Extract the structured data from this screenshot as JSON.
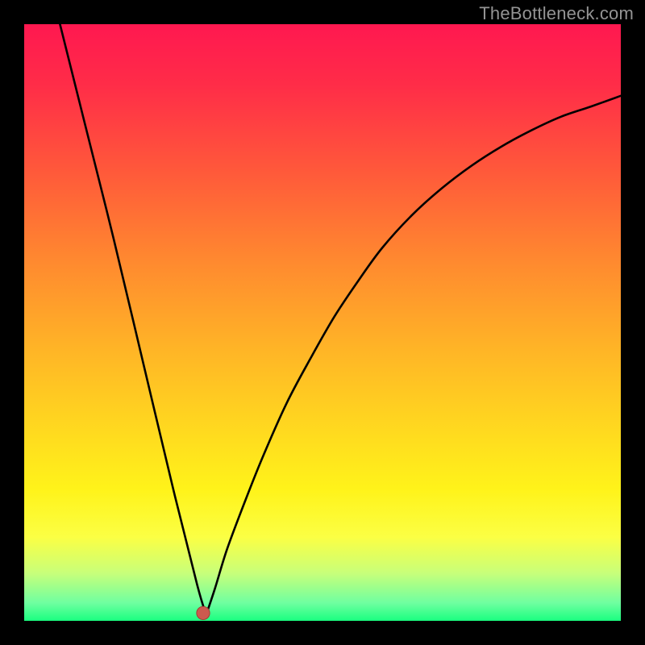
{
  "watermark": "TheBottleneck.com",
  "colors": {
    "frame": "#000000",
    "gradient_stops": [
      {
        "offset": 0.0,
        "color": "#ff1850"
      },
      {
        "offset": 0.1,
        "color": "#ff2c48"
      },
      {
        "offset": 0.25,
        "color": "#ff5a3a"
      },
      {
        "offset": 0.4,
        "color": "#ff8a2f"
      },
      {
        "offset": 0.55,
        "color": "#ffb626"
      },
      {
        "offset": 0.68,
        "color": "#ffd91f"
      },
      {
        "offset": 0.78,
        "color": "#fff31a"
      },
      {
        "offset": 0.86,
        "color": "#fbff44"
      },
      {
        "offset": 0.92,
        "color": "#c8ff7a"
      },
      {
        "offset": 0.97,
        "color": "#6fffa0"
      },
      {
        "offset": 1.0,
        "color": "#1aff80"
      }
    ]
  },
  "chart_data": {
    "type": "line",
    "title": "",
    "xlabel": "",
    "ylabel": "",
    "xlim": [
      0,
      1
    ],
    "ylim": [
      0,
      1
    ],
    "x_min_pt": 0.305,
    "left_branch": {
      "x": [
        0.06,
        0.1,
        0.15,
        0.2,
        0.25,
        0.29,
        0.305
      ],
      "y": [
        1.0,
        0.84,
        0.64,
        0.43,
        0.22,
        0.06,
        0.01
      ]
    },
    "right_branch": {
      "x": [
        0.305,
        0.32,
        0.34,
        0.37,
        0.4,
        0.44,
        0.48,
        0.52,
        0.56,
        0.6,
        0.65,
        0.7,
        0.75,
        0.8,
        0.85,
        0.9,
        0.95,
        1.0
      ],
      "y": [
        0.01,
        0.055,
        0.12,
        0.2,
        0.275,
        0.365,
        0.44,
        0.51,
        0.57,
        0.625,
        0.68,
        0.725,
        0.763,
        0.795,
        0.822,
        0.845,
        0.862,
        0.88
      ]
    },
    "marker": {
      "x": 0.3,
      "y": 0.013,
      "r": 0.011
    }
  }
}
